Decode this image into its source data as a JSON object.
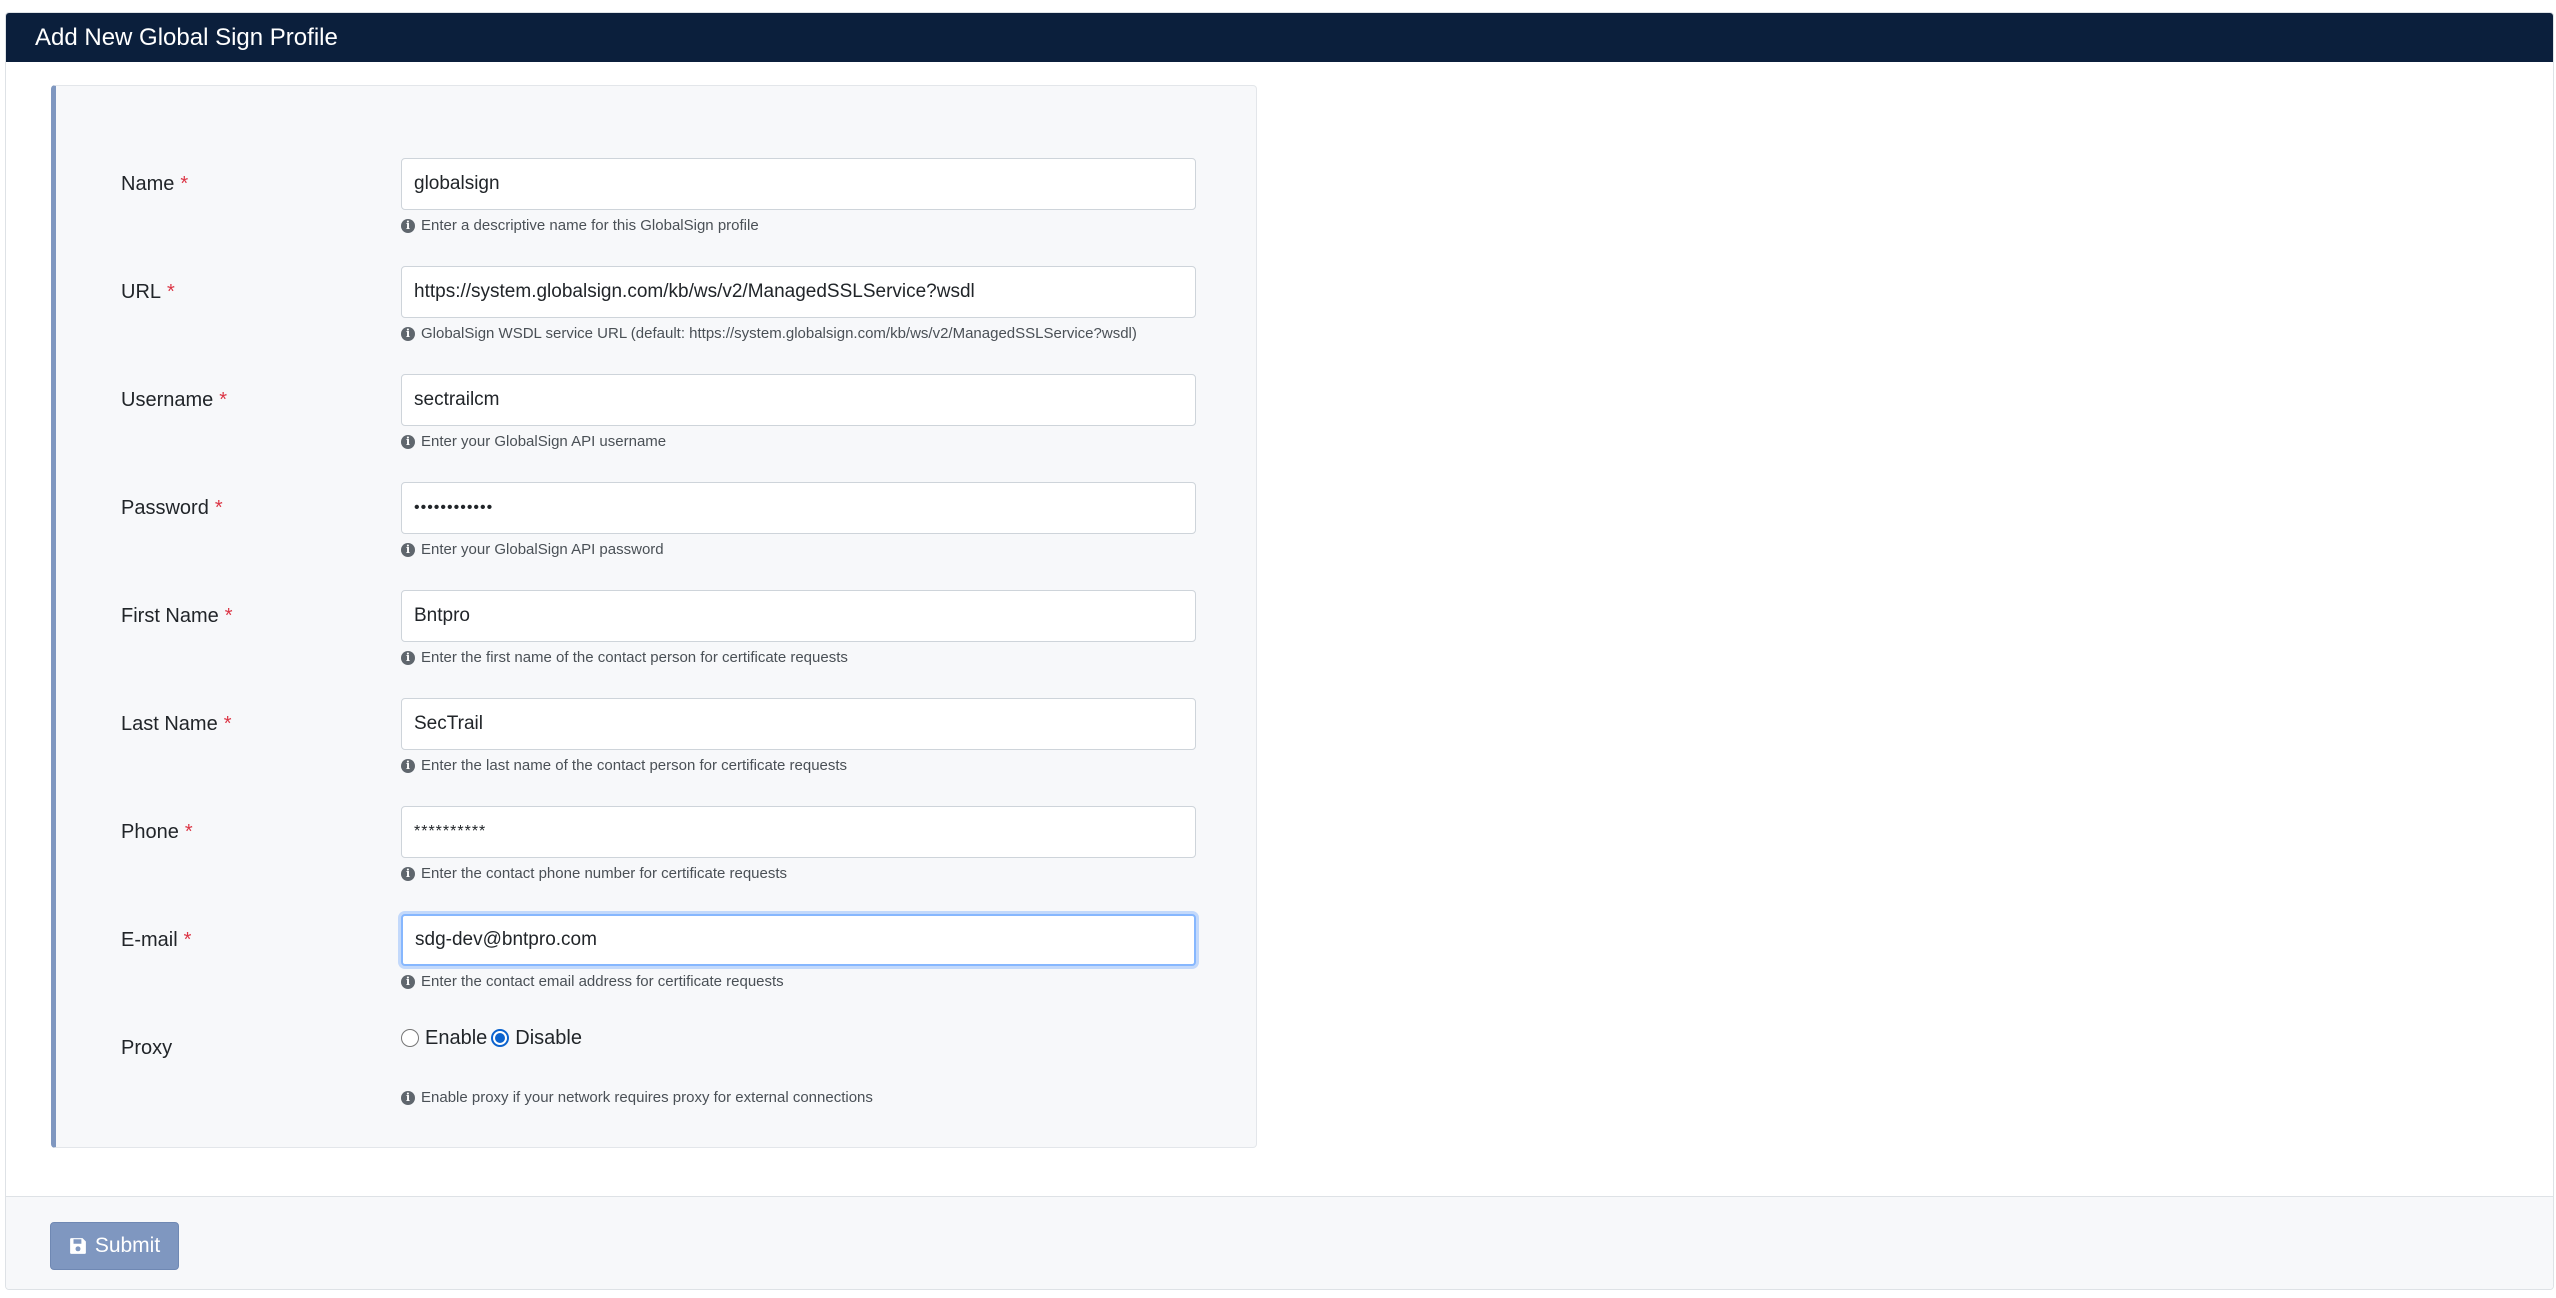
{
  "header": {
    "title": "Add New Global Sign Profile"
  },
  "form": {
    "required_mark": "*",
    "info_glyph": "i",
    "fields": {
      "name": {
        "label": "Name",
        "value": "globalsign",
        "help": "Enter a descriptive name for this GlobalSign profile"
      },
      "url": {
        "label": "URL",
        "value": "https://system.globalsign.com/kb/ws/v2/ManagedSSLService?wsdl",
        "help": "GlobalSign WSDL service URL (default: https://system.globalsign.com/kb/ws/v2/ManagedSSLService?wsdl)"
      },
      "username": {
        "label": "Username",
        "value": "sectrailcm",
        "help": "Enter your GlobalSign API username"
      },
      "password": {
        "label": "Password",
        "value": "••••••••••••",
        "help": "Enter your GlobalSign API password"
      },
      "first_name": {
        "label": "First Name",
        "value": "Bntpro",
        "help": "Enter the first name of the contact person for certificate requests"
      },
      "last_name": {
        "label": "Last Name",
        "value": "SecTrail",
        "help": "Enter the last name of the contact person for certificate requests"
      },
      "phone": {
        "label": "Phone",
        "value": "**********",
        "help": "Enter the contact phone number for certificate requests"
      },
      "email": {
        "label": "E-mail",
        "value": "sdg-dev@bntpro.com",
        "help": "Enter the contact email address for certificate requests"
      },
      "proxy": {
        "label": "Proxy",
        "options": [
          "Enable",
          "Disable"
        ],
        "selected": "Disable",
        "help": "Enable proxy if your network requires proxy for external connections"
      }
    }
  },
  "footer": {
    "submit_label": "Submit",
    "submit_icon": "save-icon"
  },
  "colors": {
    "header_bg": "#0b1f3c",
    "panel_accent": "#7f97c0",
    "required": "#dc3545",
    "radio_checked": "#0b63ce",
    "submit_bg": "#7f97c0"
  }
}
